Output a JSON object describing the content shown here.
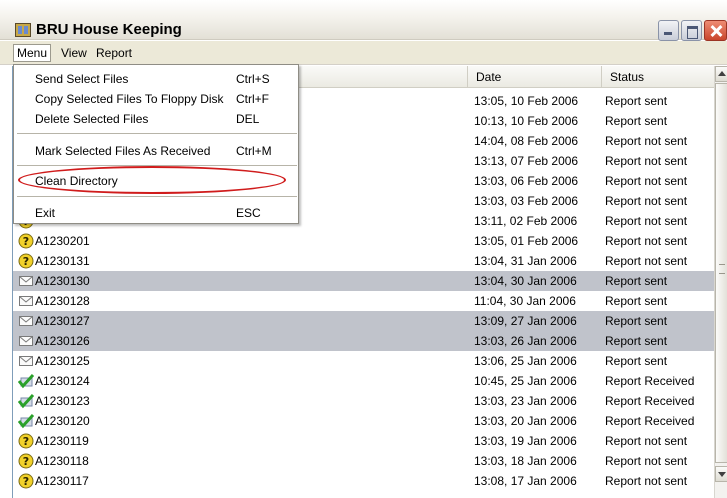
{
  "window": {
    "title": "BRU House Keeping"
  },
  "menubar": {
    "items": [
      "Menu",
      "View",
      "Report"
    ]
  },
  "list": {
    "columns": {
      "date": "Date",
      "status": "Status"
    },
    "rows": [
      {
        "name": "",
        "date": "13:05, 10 Feb 2006",
        "status": "Report sent",
        "icon": "envelope-icon",
        "selected": false
      },
      {
        "name": "",
        "date": "10:13, 10 Feb 2006",
        "status": "Report sent",
        "icon": "envelope-icon",
        "selected": false
      },
      {
        "name": "",
        "date": "14:04, 08 Feb 2006",
        "status": "Report not sent",
        "icon": "question-icon",
        "selected": false
      },
      {
        "name": "",
        "date": "13:13, 07 Feb 2006",
        "status": "Report not sent",
        "icon": "question-icon",
        "selected": false
      },
      {
        "name": "",
        "date": "13:03, 06 Feb 2006",
        "status": "Report not sent",
        "icon": "question-icon",
        "selected": false
      },
      {
        "name": "",
        "date": "13:03, 03 Feb 2006",
        "status": "Report not sent",
        "icon": "question-icon",
        "selected": false
      },
      {
        "name": "",
        "date": "13:11, 02 Feb 2006",
        "status": "Report not sent",
        "icon": "question-icon",
        "selected": false
      },
      {
        "name": "A1230201",
        "date": "13:05, 01 Feb 2006",
        "status": "Report not sent",
        "icon": "question-icon",
        "selected": false
      },
      {
        "name": "A1230131",
        "date": "13:04, 31 Jan 2006",
        "status": "Report not sent",
        "icon": "question-icon",
        "selected": false
      },
      {
        "name": "A1230130",
        "date": "13:04, 30 Jan 2006",
        "status": "Report sent",
        "icon": "envelope-icon",
        "selected": true
      },
      {
        "name": "A1230128",
        "date": "11:04, 30 Jan 2006",
        "status": "Report sent",
        "icon": "envelope-icon",
        "selected": false
      },
      {
        "name": "A1230127",
        "date": "13:09, 27 Jan 2006",
        "status": "Report sent",
        "icon": "envelope-icon",
        "selected": true
      },
      {
        "name": "A1230126",
        "date": "13:03, 26 Jan 2006",
        "status": "Report sent",
        "icon": "envelope-icon",
        "selected": true
      },
      {
        "name": "A1230125",
        "date": "13:06, 25 Jan 2006",
        "status": "Report sent",
        "icon": "envelope-icon",
        "selected": false
      },
      {
        "name": "A1230124",
        "date": "10:45, 25 Jan 2006",
        "status": "Report Received",
        "icon": "checkmark-icon",
        "selected": false
      },
      {
        "name": "A1230123",
        "date": "13:03, 23 Jan 2006",
        "status": "Report Received",
        "icon": "checkmark-icon",
        "selected": false
      },
      {
        "name": "A1230120",
        "date": "13:03, 20 Jan 2006",
        "status": "Report Received",
        "icon": "checkmark-icon",
        "selected": false
      },
      {
        "name": "A1230119",
        "date": "13:03, 19 Jan 2006",
        "status": "Report not sent",
        "icon": "question-icon",
        "selected": false
      },
      {
        "name": "A1230118",
        "date": "13:03, 18 Jan 2006",
        "status": "Report not sent",
        "icon": "question-icon",
        "selected": false
      },
      {
        "name": "A1230117",
        "date": "13:08, 17 Jan 2006",
        "status": "Report not sent",
        "icon": "question-icon",
        "selected": false
      }
    ]
  },
  "menu": {
    "items": [
      {
        "label": "Send Select Files",
        "shortcut": "Ctrl+S"
      },
      {
        "label": "Copy Selected Files To Floppy Disk",
        "shortcut": "Ctrl+F"
      },
      {
        "label": "Delete Selected Files",
        "shortcut": "DEL"
      },
      {
        "label": "Mark Selected Files As Received",
        "shortcut": "Ctrl+M"
      },
      {
        "label": "Clean Directory",
        "shortcut": ""
      },
      {
        "label": "Exit",
        "shortcut": "ESC"
      }
    ]
  },
  "colors": {
    "selected_row": "#c0c3cb",
    "highlight_ellipse": "#d01c1c",
    "check_green": "#2aa02a",
    "question_yellow": "#f2d22a"
  }
}
